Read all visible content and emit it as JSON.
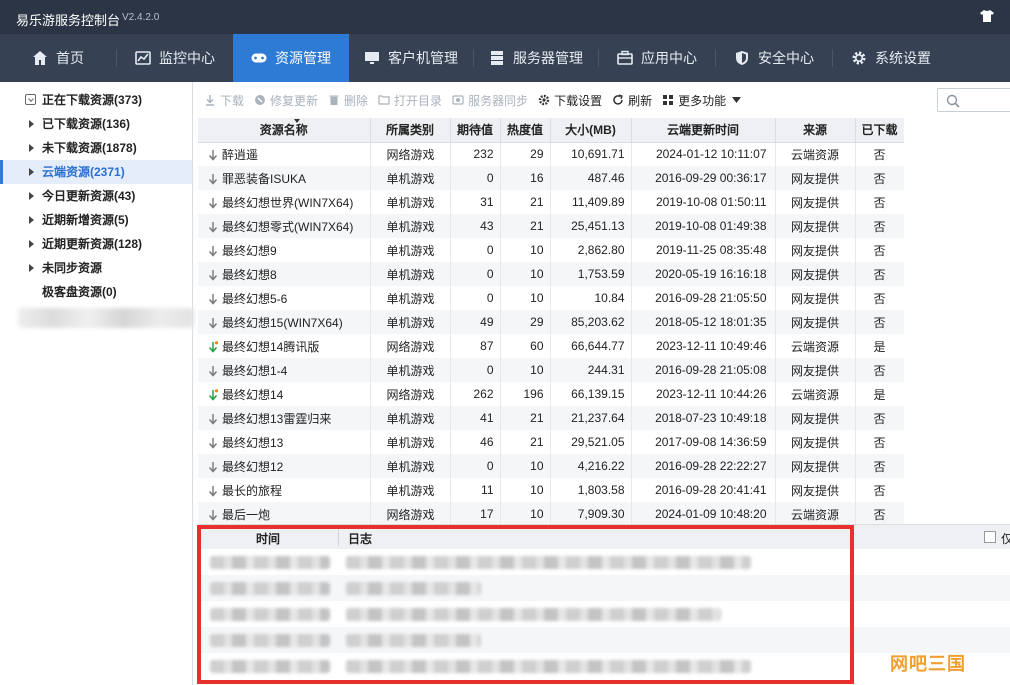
{
  "window": {
    "title": "易乐游服务控制台",
    "version": "V2.4.2.0",
    "skin_icon": "shirt-icon"
  },
  "nav": [
    {
      "label": "首页",
      "icon": "home-icon",
      "active": false
    },
    {
      "label": "监控中心",
      "icon": "chart-icon",
      "active": false
    },
    {
      "label": "资源管理",
      "icon": "gamepad-icon",
      "active": true
    },
    {
      "label": "客户机管理",
      "icon": "monitor-icon",
      "active": false
    },
    {
      "label": "服务器管理",
      "icon": "server-icon",
      "active": false
    },
    {
      "label": "应用中心",
      "icon": "briefcase-icon",
      "active": false
    },
    {
      "label": "安全中心",
      "icon": "shield-icon",
      "active": false
    },
    {
      "label": "系统设置",
      "icon": "gear-icon",
      "active": false
    }
  ],
  "sidebar": {
    "items": [
      {
        "label": "正在下载资源(373)",
        "marker": "download-box"
      },
      {
        "label": "已下载资源(136)",
        "marker": "arrow"
      },
      {
        "label": "未下载资源(1878)",
        "marker": "arrow"
      },
      {
        "label": "云端资源(2371)",
        "marker": "arrow",
        "selected": true
      },
      {
        "label": "今日更新资源(43)",
        "marker": "arrow"
      },
      {
        "label": "近期新增资源(5)",
        "marker": "arrow"
      },
      {
        "label": "近期更新资源(128)",
        "marker": "arrow"
      },
      {
        "label": "未同步资源",
        "marker": "arrow"
      },
      {
        "label": "极客盘资源(0)",
        "marker": "none"
      }
    ]
  },
  "toolbar": {
    "download": "下载",
    "repair": "修复更新",
    "delete": "删除",
    "open_dir": "打开目录",
    "server_sync": "服务器同步",
    "download_settings": "下载设置",
    "refresh": "刷新",
    "more": "更多功能"
  },
  "table": {
    "headers": [
      "资源名称",
      "所属类别",
      "期待值",
      "热度值",
      "大小(MB)",
      "云端更新时间",
      "来源",
      "已下载"
    ],
    "rows": [
      {
        "name": "醉逍遥",
        "cat": "网络游戏",
        "exp": "232",
        "heat": "29",
        "size": "10,691.71",
        "time": "2024-01-12 10:11:07",
        "src": "云端资源",
        "dl": "否",
        "icon": "plain"
      },
      {
        "name": "罪恶装备ISUKA",
        "cat": "单机游戏",
        "exp": "0",
        "heat": "16",
        "size": "487.46",
        "time": "2016-09-29 00:36:17",
        "src": "网友提供",
        "dl": "否",
        "icon": "plain"
      },
      {
        "name": "最终幻想世界(WIN7X64)",
        "cat": "单机游戏",
        "exp": "31",
        "heat": "21",
        "size": "11,409.89",
        "time": "2019-10-08 01:50:11",
        "src": "网友提供",
        "dl": "否",
        "icon": "plain"
      },
      {
        "name": "最终幻想零式(WIN7X64)",
        "cat": "单机游戏",
        "exp": "43",
        "heat": "21",
        "size": "25,451.13",
        "time": "2019-10-08 01:49:38",
        "src": "网友提供",
        "dl": "否",
        "icon": "plain"
      },
      {
        "name": "最终幻想9",
        "cat": "单机游戏",
        "exp": "0",
        "heat": "10",
        "size": "2,862.80",
        "time": "2019-11-25 08:35:48",
        "src": "网友提供",
        "dl": "否",
        "icon": "plain"
      },
      {
        "name": "最终幻想8",
        "cat": "单机游戏",
        "exp": "0",
        "heat": "10",
        "size": "1,753.59",
        "time": "2020-05-19 16:16:18",
        "src": "网友提供",
        "dl": "否",
        "icon": "plain"
      },
      {
        "name": "最终幻想5-6",
        "cat": "单机游戏",
        "exp": "0",
        "heat": "10",
        "size": "10.84",
        "time": "2016-09-28 21:05:50",
        "src": "网友提供",
        "dl": "否",
        "icon": "plain"
      },
      {
        "name": "最终幻想15(WIN7X64)",
        "cat": "单机游戏",
        "exp": "49",
        "heat": "29",
        "size": "85,203.62",
        "time": "2018-05-12 18:01:35",
        "src": "网友提供",
        "dl": "否",
        "icon": "plain"
      },
      {
        "name": "最终幻想14腾讯版",
        "cat": "网络游戏",
        "exp": "87",
        "heat": "60",
        "size": "66,644.77",
        "time": "2023-12-11 10:49:46",
        "src": "云端资源",
        "dl": "是",
        "icon": "downloaded"
      },
      {
        "name": "最终幻想1-4",
        "cat": "单机游戏",
        "exp": "0",
        "heat": "10",
        "size": "244.31",
        "time": "2016-09-28 21:05:08",
        "src": "网友提供",
        "dl": "否",
        "icon": "plain"
      },
      {
        "name": "最终幻想14",
        "cat": "网络游戏",
        "exp": "262",
        "heat": "196",
        "size": "66,139.15",
        "time": "2023-12-11 10:44:26",
        "src": "云端资源",
        "dl": "是",
        "icon": "downloaded"
      },
      {
        "name": "最终幻想13雷霆归来",
        "cat": "单机游戏",
        "exp": "41",
        "heat": "21",
        "size": "21,237.64",
        "time": "2018-07-23 10:49:18",
        "src": "网友提供",
        "dl": "否",
        "icon": "plain"
      },
      {
        "name": "最终幻想13",
        "cat": "单机游戏",
        "exp": "46",
        "heat": "21",
        "size": "29,521.05",
        "time": "2017-09-08 14:36:59",
        "src": "网友提供",
        "dl": "否",
        "icon": "plain"
      },
      {
        "name": "最终幻想12",
        "cat": "单机游戏",
        "exp": "0",
        "heat": "10",
        "size": "4,216.22",
        "time": "2016-09-28 22:22:27",
        "src": "网友提供",
        "dl": "否",
        "icon": "plain"
      },
      {
        "name": "最长的旅程",
        "cat": "单机游戏",
        "exp": "11",
        "heat": "10",
        "size": "1,803.58",
        "time": "2016-09-28 20:41:41",
        "src": "网友提供",
        "dl": "否",
        "icon": "plain"
      },
      {
        "name": "最后一炮",
        "cat": "网络游戏",
        "exp": "17",
        "heat": "10",
        "size": "7,909.30",
        "time": "2024-01-09 10:48:20",
        "src": "云端资源",
        "dl": "否",
        "icon": "plain"
      }
    ]
  },
  "log": {
    "header_time": "时间",
    "header_log": "日志",
    "only_label": "仅"
  },
  "watermark": "网吧三国",
  "colors": {
    "titlebar": "#2b3545",
    "nav_bg": "#364254",
    "nav_active": "#2e7bd6",
    "highlight": "#e8302f",
    "watermark": "#f0a030"
  }
}
